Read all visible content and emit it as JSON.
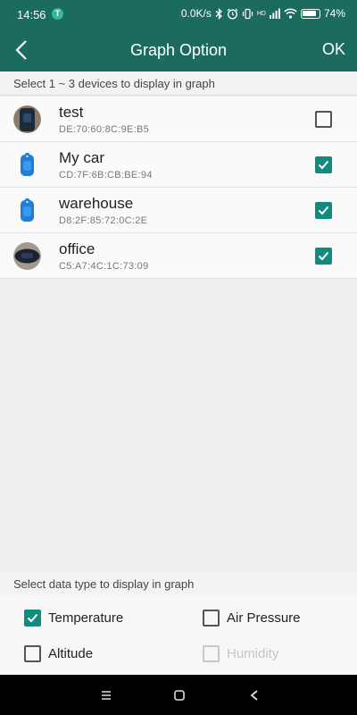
{
  "status_bar": {
    "time": "14:56",
    "app_icon": "t-app-icon",
    "network_speed": "0.0K/s",
    "signal_label": "HD",
    "battery": "74%"
  },
  "app_bar": {
    "back_icon": "arrow-left-icon",
    "title": "Graph Option",
    "ok_label": "OK"
  },
  "device_section": {
    "header": "Select 1 ~ 3 devices to display in graph",
    "devices": [
      {
        "name": "test",
        "mac": "DE:70:60:8C:9E:B5",
        "checked": false,
        "thumb": "dark-device-photo"
      },
      {
        "name": "My car",
        "mac": "CD:7F:6B:CB:BE:94",
        "checked": true,
        "thumb": "blue-tag-icon"
      },
      {
        "name": "warehouse",
        "mac": "D8:2F:85:72:0C:2E",
        "checked": true,
        "thumb": "blue-tag-icon"
      },
      {
        "name": "office",
        "mac": "C5:A7:4C:1C:73:09",
        "checked": true,
        "thumb": "dark-device-photo"
      }
    ]
  },
  "data_type_section": {
    "header": "Select data type to display in graph",
    "types": [
      {
        "label": "Temperature",
        "checked": true,
        "enabled": true
      },
      {
        "label": "Air Pressure",
        "checked": false,
        "enabled": true
      },
      {
        "label": "Altitude",
        "checked": false,
        "enabled": true
      },
      {
        "label": "Humidity",
        "checked": false,
        "enabled": false
      }
    ]
  },
  "nav_bar": {
    "menu_icon": "menu-icon",
    "home_icon": "home-square-icon",
    "back_icon": "triangle-back-icon"
  },
  "colors": {
    "primary": "#1b6b5f",
    "checkbox_checked": "#128a80"
  }
}
